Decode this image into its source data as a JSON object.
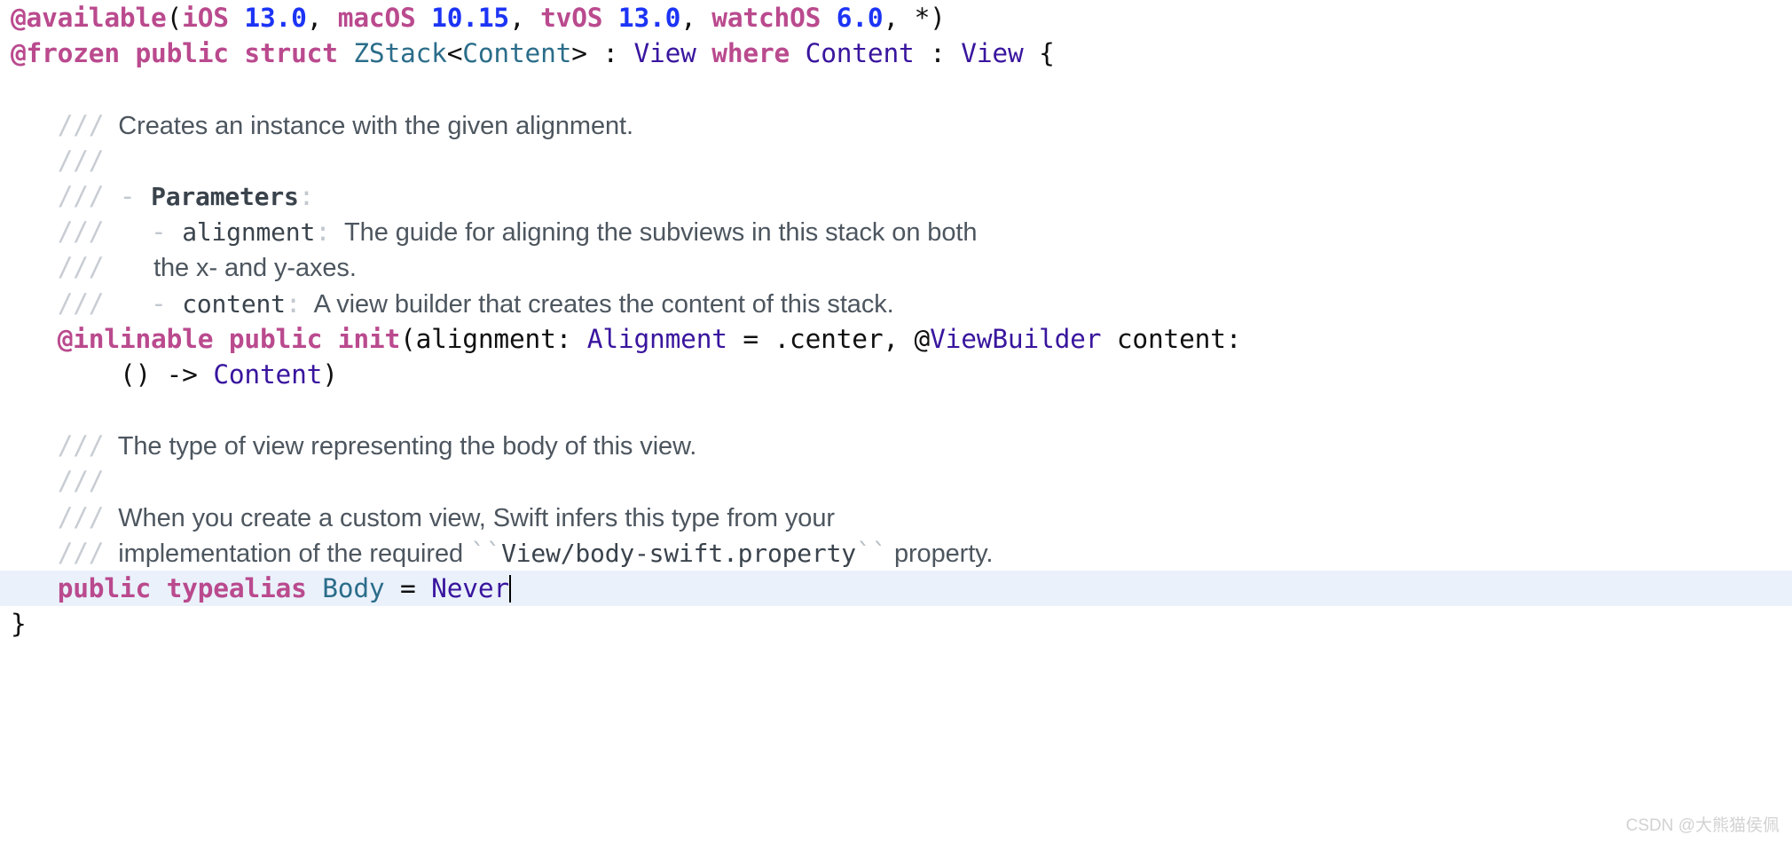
{
  "editor": {
    "language": "swift",
    "file_symbol": "ZStack",
    "colors": {
      "background": "#ffffff",
      "keyword": "#ba4a8e",
      "number": "#1c34f5",
      "type_declared": "#2b6d8a",
      "type_referenced": "#39159e",
      "plain_text": "#101010",
      "comment_slashes": "#c8cdd3",
      "comment_prose": "#4d565f",
      "comment_code": "#3a434c",
      "line_highlight": "#eaf1fb",
      "caret": "#000000",
      "watermark": "#d2d2d2"
    },
    "lines": [
      {
        "id": "line-available-attribute",
        "type": "code",
        "tokens": [
          {
            "style": "kw",
            "text": "@available"
          },
          {
            "style": "plain",
            "text": "("
          },
          {
            "style": "kw",
            "text": "iOS"
          },
          {
            "style": "plain",
            "text": " "
          },
          {
            "style": "num",
            "text": "13.0"
          },
          {
            "style": "plain",
            "text": ", "
          },
          {
            "style": "kw",
            "text": "macOS"
          },
          {
            "style": "plain",
            "text": " "
          },
          {
            "style": "num",
            "text": "10.15"
          },
          {
            "style": "plain",
            "text": ", "
          },
          {
            "style": "kw",
            "text": "tvOS"
          },
          {
            "style": "plain",
            "text": " "
          },
          {
            "style": "num",
            "text": "13.0"
          },
          {
            "style": "plain",
            "text": ", "
          },
          {
            "style": "kw",
            "text": "watchOS"
          },
          {
            "style": "plain",
            "text": " "
          },
          {
            "style": "num",
            "text": "6.0"
          },
          {
            "style": "plain",
            "text": ", *)"
          }
        ]
      },
      {
        "id": "line-struct-declaration",
        "type": "code",
        "tokens": [
          {
            "style": "kw",
            "text": "@frozen public struct"
          },
          {
            "style": "plain",
            "text": " "
          },
          {
            "style": "type-teal",
            "text": "ZStack"
          },
          {
            "style": "plain",
            "text": "<"
          },
          {
            "style": "type-teal",
            "text": "Content"
          },
          {
            "style": "plain",
            "text": "> : "
          },
          {
            "style": "type-purp",
            "text": "View"
          },
          {
            "style": "plain",
            "text": " "
          },
          {
            "style": "kw",
            "text": "where"
          },
          {
            "style": "plain",
            "text": " "
          },
          {
            "style": "type-purp",
            "text": "Content"
          },
          {
            "style": "plain",
            "text": " : "
          },
          {
            "style": "type-purp",
            "text": "View"
          },
          {
            "style": "plain",
            "text": " {"
          }
        ]
      },
      {
        "id": "line-blank-1",
        "type": "blank",
        "tokens": []
      },
      {
        "id": "line-doc-creates-instance",
        "type": "doc",
        "indent": 3,
        "tokens": [
          {
            "style": "slashes",
            "text": "///"
          },
          {
            "style": "doc-prose",
            "text": "  Creates an instance with the given alignment."
          }
        ]
      },
      {
        "id": "line-doc-empty-1",
        "type": "doc",
        "indent": 3,
        "tokens": [
          {
            "style": "slashes",
            "text": "///"
          }
        ]
      },
      {
        "id": "line-doc-parameters-heading",
        "type": "doc",
        "indent": 3,
        "tokens": [
          {
            "style": "slashes",
            "text": "///"
          },
          {
            "style": "doc-punct",
            "text": " - "
          },
          {
            "style": "doc-mono-bold",
            "text": "Parameters"
          },
          {
            "style": "doc-punct",
            "text": ":"
          }
        ]
      },
      {
        "id": "line-doc-param-alignment",
        "type": "doc",
        "indent": 3,
        "tokens": [
          {
            "style": "slashes",
            "text": "///"
          },
          {
            "style": "doc-punct",
            "text": "   - "
          },
          {
            "style": "doc-mono",
            "text": "alignment"
          },
          {
            "style": "doc-punct",
            "text": ":"
          },
          {
            "style": "doc-prose",
            "text": "  The guide for aligning the subviews in this stack on both"
          }
        ]
      },
      {
        "id": "line-doc-param-alignment-cont",
        "type": "doc",
        "indent": 3,
        "tokens": [
          {
            "style": "slashes",
            "text": "///"
          },
          {
            "style": "doc-prose",
            "text": "       the x- and y-axes."
          }
        ]
      },
      {
        "id": "line-doc-param-content",
        "type": "doc",
        "indent": 3,
        "tokens": [
          {
            "style": "slashes",
            "text": "///"
          },
          {
            "style": "doc-punct",
            "text": "   - "
          },
          {
            "style": "doc-mono",
            "text": "content"
          },
          {
            "style": "doc-punct",
            "text": ":"
          },
          {
            "style": "doc-prose",
            "text": "  A view builder that creates the content of this stack."
          }
        ]
      },
      {
        "id": "line-init-signature",
        "type": "code",
        "indent": 3,
        "tokens": [
          {
            "style": "kw",
            "text": "@inlinable public init"
          },
          {
            "style": "plain",
            "text": "(alignment: "
          },
          {
            "style": "type-purp",
            "text": "Alignment"
          },
          {
            "style": "plain",
            "text": " = .center, "
          },
          {
            "style": "plain",
            "text": "@"
          },
          {
            "style": "type-purp",
            "text": "ViewBuilder"
          },
          {
            "style": "plain",
            "text": " content:"
          }
        ]
      },
      {
        "id": "line-init-signature-cont",
        "type": "code",
        "indent": 7,
        "tokens": [
          {
            "style": "plain",
            "text": "() -> "
          },
          {
            "style": "type-purp",
            "text": "Content"
          },
          {
            "style": "plain",
            "text": ")"
          }
        ]
      },
      {
        "id": "line-blank-2",
        "type": "blank",
        "tokens": []
      },
      {
        "id": "line-doc-body-type",
        "type": "doc",
        "indent": 3,
        "tokens": [
          {
            "style": "slashes",
            "text": "///"
          },
          {
            "style": "doc-prose",
            "text": "  The type of view representing the body of this view."
          }
        ]
      },
      {
        "id": "line-doc-empty-2",
        "type": "doc",
        "indent": 3,
        "tokens": [
          {
            "style": "slashes",
            "text": "///"
          }
        ]
      },
      {
        "id": "line-doc-custom-view",
        "type": "doc",
        "indent": 3,
        "tokens": [
          {
            "style": "slashes",
            "text": "///"
          },
          {
            "style": "doc-prose",
            "text": "  When you create a custom view, Swift infers this type from your"
          }
        ]
      },
      {
        "id": "line-doc-implementation",
        "type": "doc",
        "indent": 3,
        "tokens": [
          {
            "style": "slashes",
            "text": "///"
          },
          {
            "style": "doc-prose",
            "text": "  implementation of the required "
          },
          {
            "style": "doc-tick",
            "text": "``"
          },
          {
            "style": "doc-mono",
            "text": "View/body-swift.property"
          },
          {
            "style": "doc-tick",
            "text": "``"
          },
          {
            "style": "doc-prose",
            "text": " property."
          }
        ]
      },
      {
        "id": "line-typealias-body",
        "type": "code",
        "indent": 3,
        "highlighted": true,
        "caret": true,
        "tokens": [
          {
            "style": "kw",
            "text": "public typealias"
          },
          {
            "style": "plain",
            "text": " "
          },
          {
            "style": "type-teal",
            "text": "Body"
          },
          {
            "style": "plain",
            "text": " = "
          },
          {
            "style": "type-purp",
            "text": "Never"
          }
        ]
      },
      {
        "id": "line-closing-brace",
        "type": "code",
        "tokens": [
          {
            "style": "plain",
            "text": "}"
          }
        ]
      }
    ]
  },
  "watermark": {
    "text": "CSDN @大熊猫侯佩"
  }
}
